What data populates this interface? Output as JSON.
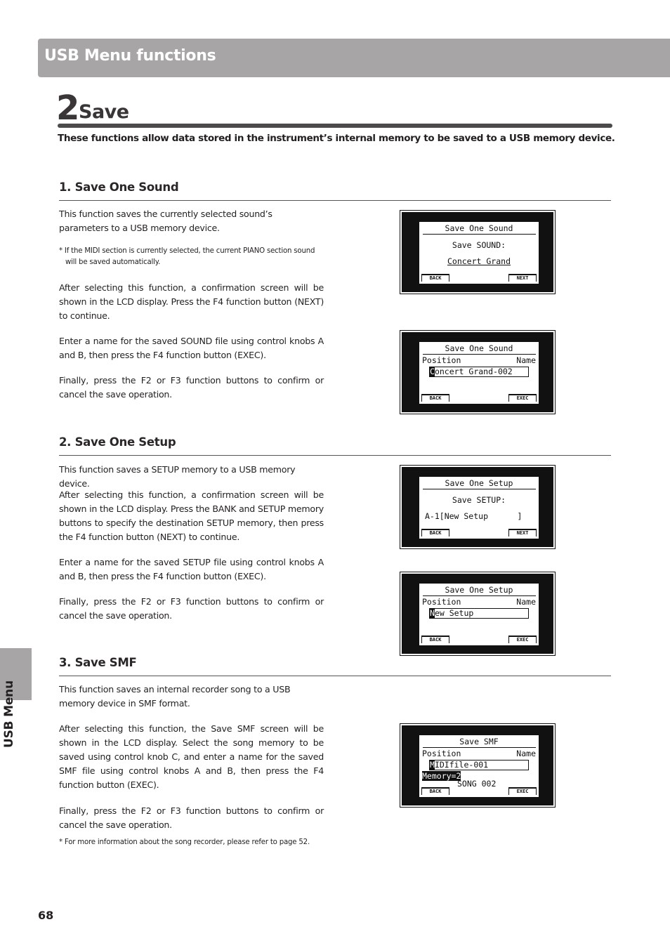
{
  "header": {
    "banner_title": "USB Menu functions"
  },
  "chapter": {
    "number": "2",
    "title": "Save",
    "intro": "These functions allow data stored in the instrument’s internal memory to be saved to a USB memory device."
  },
  "sections": [
    {
      "title": "1. Save One Sound",
      "paragraphs": [
        "This function saves the currently selected sound’s parameters to a USB memory device.",
        "After selecting this function, a confirmation screen will be shown in the LCD display.  Press the F4 function button (NEXT) to continue.",
        "Enter a name for the saved SOUND file using control knobs A and B, then press the F4 function button (EXEC).",
        "Finally, press the F2 or F3 function buttons to confirm or cancel the save operation."
      ],
      "note": {
        "line1": "* If the MIDI section is currently selected, the current PIANO section sound",
        "line2": "will be saved automatically."
      },
      "screens": [
        {
          "title": "Save One Sound",
          "line1": "Save SOUND:",
          "line2": "Concert Grand",
          "left_button": "BACK",
          "right_button": "NEXT"
        },
        {
          "title": "Save One Sound",
          "position_label": "Position",
          "name_label": "Name",
          "field_cursor": "C",
          "field_rest": "oncert Grand-002",
          "left_button": "BACK",
          "right_button": "EXEC"
        }
      ]
    },
    {
      "title": "2. Save One Setup",
      "paragraphs": [
        "This function saves a SETUP memory to a USB memory device.",
        "After selecting this function, a confirmation screen will be shown in the LCD display.  Press the BANK and SETUP memory buttons to specify the destination SETUP memory, then press the F4 function button (NEXT) to continue.",
        "Enter a name for the saved SETUP file using control knobs A and B, then press the F4 function button (EXEC).",
        "Finally, press the F2 or F3 function buttons to confirm or cancel the save operation."
      ],
      "screens": [
        {
          "title": "Save One Setup",
          "line1": "Save SETUP:",
          "line2": "A-1[New Setup      ]",
          "left_button": "BACK",
          "right_button": "NEXT"
        },
        {
          "title": "Save One Setup",
          "position_label": "Position",
          "name_label": "Name",
          "field_cursor": "N",
          "field_rest": "ew Setup",
          "left_button": "BACK",
          "right_button": "EXEC"
        }
      ]
    },
    {
      "title": "3. Save SMF",
      "paragraphs": [
        "This function saves an internal recorder song to a USB memory device in SMF format.",
        "After selecting this function, the Save SMF screen will be shown in the LCD display.  Select the song memory to be saved using control knob C, and enter a name for the saved SMF file using control knobs A and B, then press the F4 function button (EXEC).",
        "Finally, press the F2 or F3 function buttons to confirm or cancel the save operation."
      ],
      "note": "* For more information about the song recorder, please refer to page 52.",
      "screens": [
        {
          "title": "Save SMF",
          "position_label": "Position",
          "name_label": "Name",
          "field_cursor": "M",
          "field_rest": "IDIfile-001",
          "memory": "Memory=2",
          "song": "SONG 002",
          "left_button": "BACK",
          "right_button": "EXEC"
        }
      ]
    }
  ],
  "side_tab": {
    "label": "USB Menu"
  },
  "footer": {
    "page_number": "68"
  }
}
